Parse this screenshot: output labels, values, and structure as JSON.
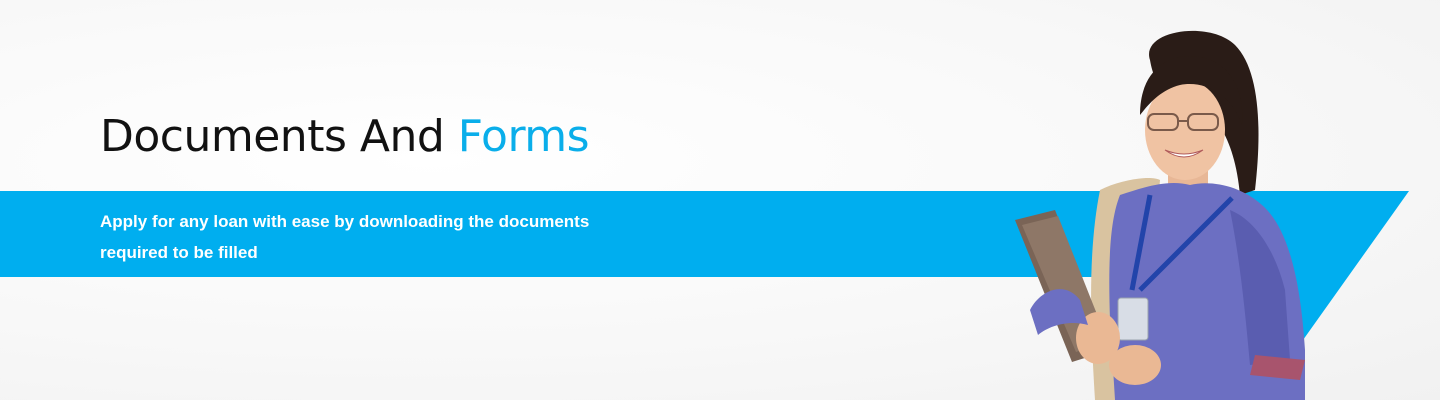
{
  "banner": {
    "title_part1": "Documents And",
    "title_part2": "Forms",
    "subtitle_line1": "Apply for any loan with ease by downloading the documents",
    "subtitle_line2": "required to be filled"
  },
  "colors": {
    "accent": "#0aaeea",
    "title": "#111111",
    "stripe": "#00aeef",
    "subtitle": "#ffffff"
  },
  "image": {
    "description_icon": "woman-holding-folder-illustration"
  }
}
